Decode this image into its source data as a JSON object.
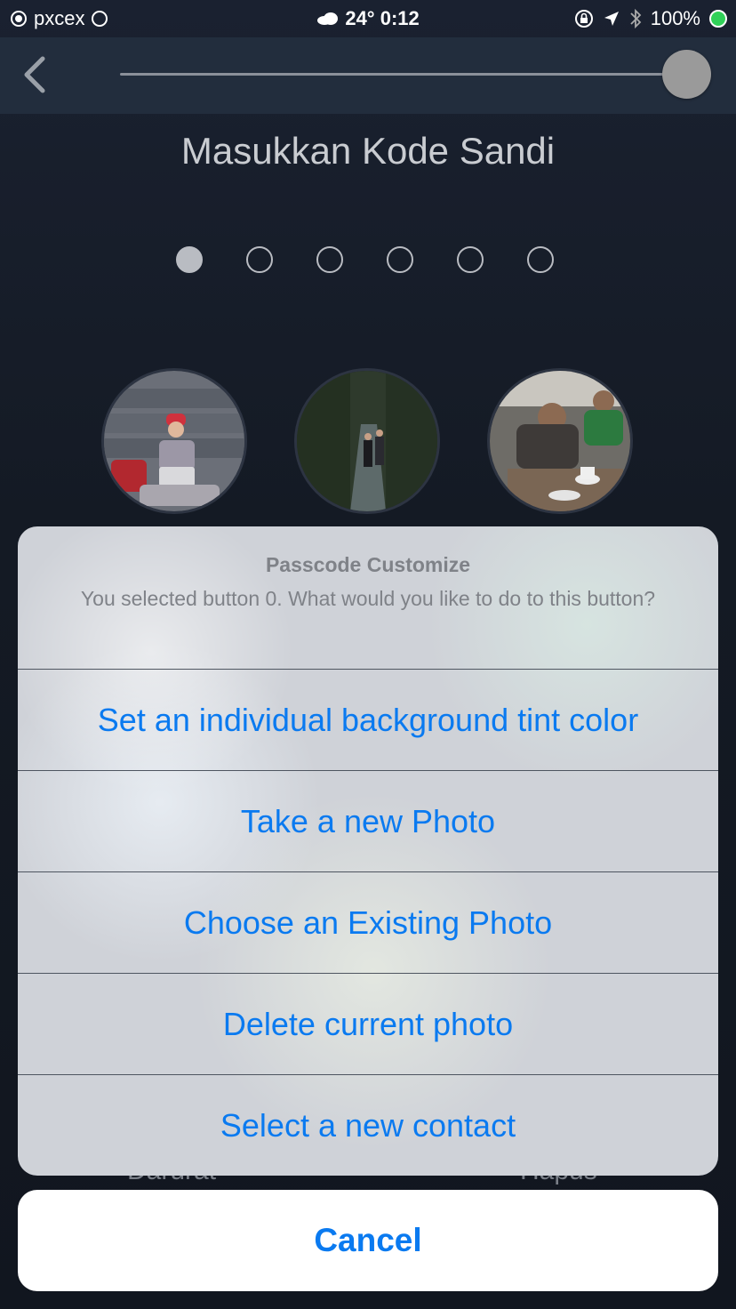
{
  "status_bar": {
    "carrier": "pxcex",
    "weather_icon": "cloud-icon",
    "temperature": "24°",
    "time": "0:12",
    "battery": "100%",
    "battery_color": "#30d158"
  },
  "top_bar": {
    "back_icon": "chevron-left-icon",
    "slider_value": 1.0
  },
  "page": {
    "title": "Masukkan Kode Sandi",
    "passcode_length": 6,
    "entered_digits": 1
  },
  "behind": {
    "left_label": "Darurat",
    "right_label": "Hapus"
  },
  "action_sheet": {
    "title": "Passcode Customize",
    "message": "You selected button 0. What would you like to do to this button?",
    "options": [
      "Set an individual background tint color",
      "Take a new Photo",
      "Choose an Existing Photo",
      "Delete current photo",
      "Select a new contact"
    ],
    "cancel_label": "Cancel"
  },
  "colors": {
    "accent": "#0a7af0",
    "top_bar": "#222d3d",
    "background": "#161b25"
  }
}
